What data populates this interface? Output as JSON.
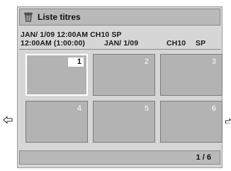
{
  "title_bar": {
    "icon": "trash-bin-icon",
    "title": "Liste titres"
  },
  "info": {
    "line1": "JAN/ 1/09 12:00AM  CH10  SP",
    "line2": {
      "time": "12:00AM (1:00:00)",
      "date": "JAN/  1/09",
      "channel": "CH10",
      "mode": "SP"
    }
  },
  "thumbnails": [
    {
      "number": "1",
      "selected": true
    },
    {
      "number": "2",
      "selected": false
    },
    {
      "number": "3",
      "selected": false
    },
    {
      "number": "4",
      "selected": false
    },
    {
      "number": "5",
      "selected": false
    },
    {
      "number": "6",
      "selected": false
    }
  ],
  "navigation": {
    "left": "left-arrow-icon",
    "right": "right-arrow-icon"
  },
  "page_indicator": "1 / 6"
}
